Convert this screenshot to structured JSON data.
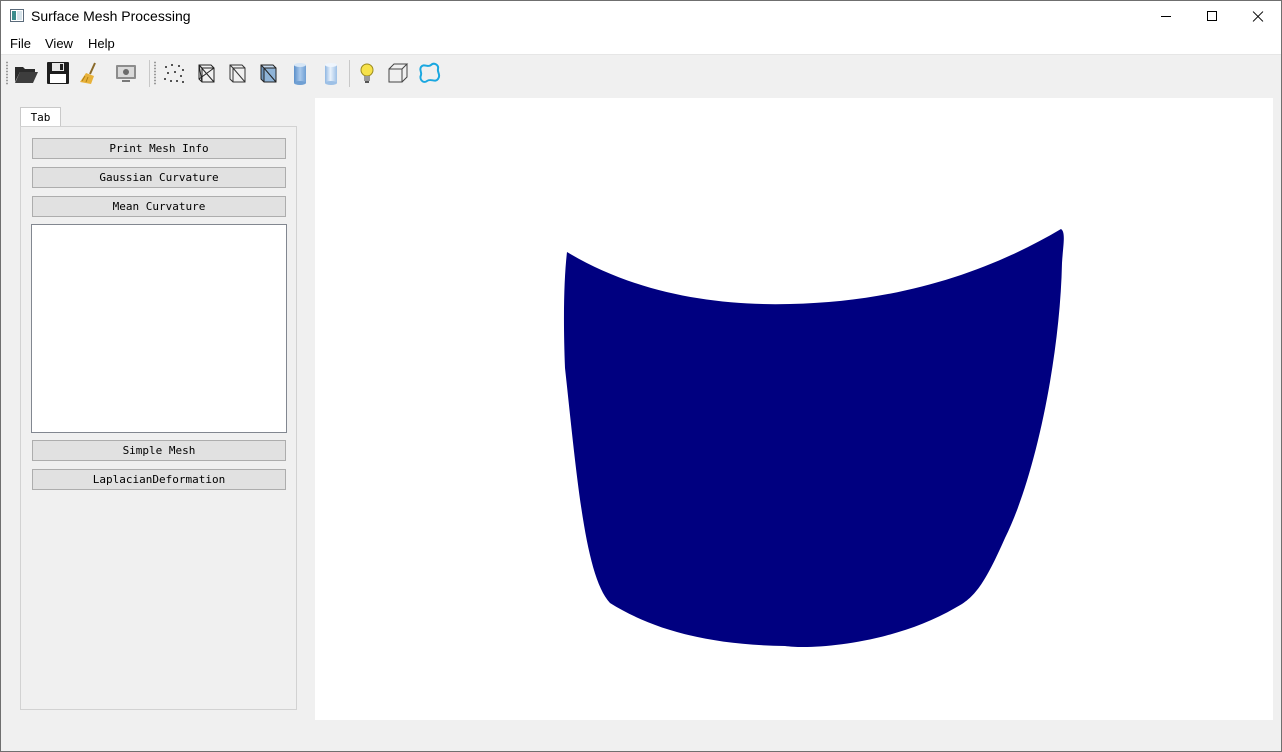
{
  "window": {
    "title": "Surface Mesh Processing"
  },
  "menubar": {
    "file": "File",
    "view": "View",
    "help": "Help"
  },
  "toolbar": {
    "icons": [
      "open-folder-icon",
      "save-icon",
      "clear-broom-icon",
      "screenshot-icon",
      "points-icon",
      "wireframe-icon",
      "hidden-line-icon",
      "flat-lines-icon",
      "flat-shading-icon",
      "smooth-shading-icon",
      "light-bulb-icon",
      "bounding-box-icon",
      "boundary-icon"
    ]
  },
  "panel": {
    "tab_label": "Tab",
    "buttons": {
      "print_mesh_info": "Print Mesh Info",
      "gaussian_curvature": "Gaussian Curvature",
      "mean_curvature": "Mean Curvature",
      "simple_mesh": "Simple Mesh",
      "laplacian_deformation": "LaplacianDeformation"
    },
    "output_text": ""
  },
  "viewport": {
    "mesh_color": "#000080",
    "background": "#ffffff"
  }
}
